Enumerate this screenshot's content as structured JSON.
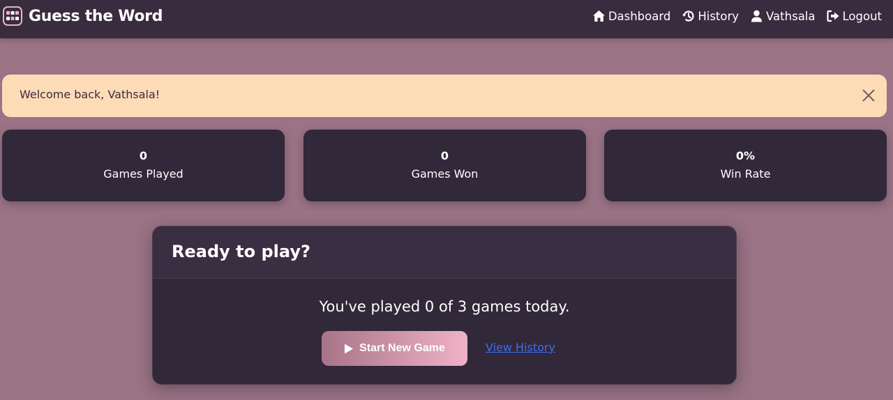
{
  "navbar": {
    "brand_name": "Guess the Word",
    "brand_icon": "tile-grid-icon",
    "links": [
      {
        "label": "Dashboard",
        "icon": "home-icon"
      },
      {
        "label": "History",
        "icon": "history-icon"
      },
      {
        "label": "Vathsala",
        "icon": "user-icon"
      },
      {
        "label": "Logout",
        "icon": "logout-icon"
      }
    ]
  },
  "alert": {
    "message": "Welcome back, Vathsala!",
    "close_icon": "close-icon"
  },
  "stats": [
    {
      "value": "0",
      "label": "Games Played"
    },
    {
      "value": "0",
      "label": "Games Won"
    },
    {
      "value": "0%",
      "label": "Win Rate"
    }
  ],
  "play_card": {
    "title": "Ready to play?",
    "summary_prefix": "You've played ",
    "played_count": "0",
    "summary_mid": " of ",
    "daily_limit": "3",
    "summary_suffix": " games today.",
    "start_button_label": "Start New Game",
    "start_button_icon": "play-icon",
    "history_link_label": "View History"
  },
  "colors": {
    "page_background": "#9a7385",
    "navbar_background": "#3a2c3f",
    "card_background": "#31283a",
    "alert_background": "#fedbb7",
    "accent_gradient_start": "#a87488",
    "accent_gradient_end": "#f0b2c8",
    "link_color": "#3d6ef0"
  }
}
